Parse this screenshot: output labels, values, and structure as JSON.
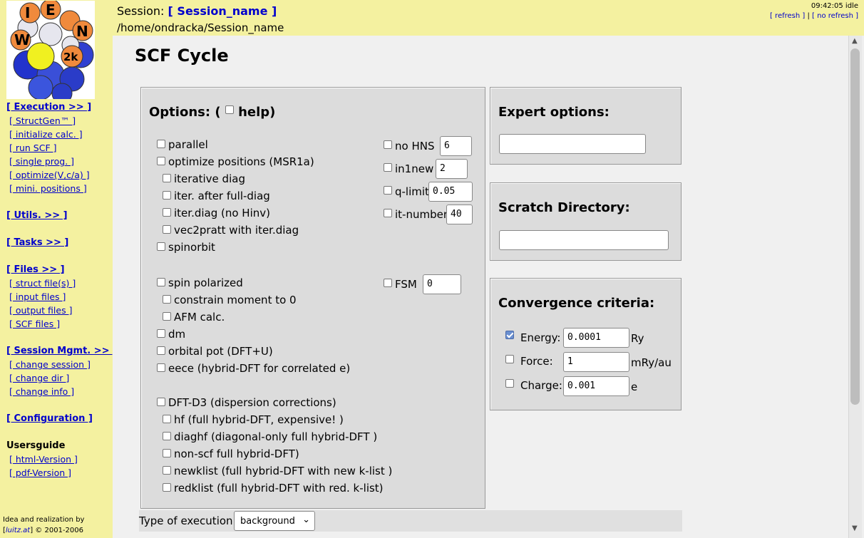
{
  "sidebar": {
    "logo_letters": [
      "W",
      "I",
      "E",
      "N",
      "2k"
    ],
    "nav": [
      {
        "label": "[ Execution >> ]",
        "style": "bold"
      },
      {
        "label": "[ StructGen™ ]",
        "style": "sub"
      },
      {
        "label": "[ initialize calc. ]",
        "style": "sub"
      },
      {
        "label": "[ run SCF ]",
        "style": "sub"
      },
      {
        "label": "[ single prog. ]",
        "style": "sub"
      },
      {
        "label": "[ optimize(V,c/a) ]",
        "style": "sub"
      },
      {
        "label": "[ mini. positions ]",
        "style": "sub"
      },
      {
        "label": "[ Utils. >> ]",
        "style": "bold"
      },
      {
        "label": "[ Tasks >> ]",
        "style": "bold"
      },
      {
        "label": "[ Files >> ]",
        "style": "bold"
      },
      {
        "label": "[ struct file(s) ]",
        "style": "sub"
      },
      {
        "label": "[ input files ]",
        "style": "sub"
      },
      {
        "label": "[ output files ]",
        "style": "sub"
      },
      {
        "label": "[ SCF files ]",
        "style": "sub"
      },
      {
        "label": "[ Session Mgmt. >> ]",
        "style": "bold"
      },
      {
        "label": "[ change session ]",
        "style": "sub"
      },
      {
        "label": "[ change dir ]",
        "style": "sub"
      },
      {
        "label": "[ change info ]",
        "style": "sub"
      },
      {
        "label": "[ Configuration ]",
        "style": "bold"
      },
      {
        "label": "Usersguide",
        "style": "plain"
      },
      {
        "label": "[ html-Version ]",
        "style": "sub"
      },
      {
        "label": "[ pdf-Version ]",
        "style": "sub"
      }
    ],
    "credit_line1": "Idea and realization by",
    "credit_link": "luitz.at",
    "credit_suffix": "© 2001-2006"
  },
  "header": {
    "session_prefix": "Session:",
    "session_name": "[ Session_name ]",
    "path": "/home/ondracka/Session_name",
    "clock": "09:42:05 idle",
    "refresh": "[ refresh ]",
    "separator": "|",
    "no_refresh": "[ no refresh ]"
  },
  "main": {
    "title": "SCF Cycle",
    "options": {
      "title_prefix": "Options: (",
      "help_label": "help)",
      "left": [
        {
          "label": "parallel",
          "checked": false
        },
        {
          "label": "optimize positions (MSR1a)",
          "checked": false
        },
        {
          "label": "iterative diag",
          "checked": false
        },
        {
          "label": "iter. after full-diag",
          "checked": false
        },
        {
          "label": "iter.diag (no Hinv)",
          "checked": false
        },
        {
          "label": "vec2pratt with iter.diag",
          "checked": false
        },
        {
          "label": "spinorbit",
          "checked": false
        },
        {
          "label": "spin polarized",
          "checked": false
        },
        {
          "label": "constrain moment to 0",
          "checked": false
        },
        {
          "label": "AFM calc.",
          "checked": false
        },
        {
          "label": "dm",
          "checked": false
        },
        {
          "label": "orbital pot (DFT+U)",
          "checked": false
        },
        {
          "label": "eece (hybrid-DFT for correlated e)",
          "checked": false
        },
        {
          "label": "DFT-D3 (dispersion corrections)",
          "checked": false
        },
        {
          "label": "hf (full hybrid-DFT, expensive! )",
          "checked": false
        },
        {
          "label": "diaghf (diagonal-only full hybrid-DFT )",
          "checked": false
        },
        {
          "label": "non-scf full hybrid-DFT)",
          "checked": false
        },
        {
          "label": "newklist (full hybrid-DFT with new k-list )",
          "checked": false
        },
        {
          "label": "redklist (full hybrid-DFT with red. k-list)",
          "checked": false
        }
      ],
      "right": [
        {
          "label": "no HNS",
          "value": "6"
        },
        {
          "label": "in1new",
          "value": "2"
        },
        {
          "label": "q-limit",
          "value": "0.05"
        },
        {
          "label": "it-number",
          "value": "40"
        },
        {
          "label": "FSM",
          "value": "0"
        }
      ]
    },
    "expert": {
      "title": "Expert options:",
      "value": ""
    },
    "scratch": {
      "title": "Scratch Directory:",
      "value": ""
    },
    "convergence": {
      "title": "Convergence criteria:",
      "rows": [
        {
          "label": "Energy:",
          "value": "0.0001",
          "unit": "Ry",
          "checked": true
        },
        {
          "label": "Force:",
          "value": "1",
          "unit": "mRy/au",
          "checked": false
        },
        {
          "label": "Charge:",
          "value": "0.001",
          "unit": "e",
          "checked": false
        }
      ]
    },
    "execution": {
      "label": "Type of execution:",
      "selected": "background"
    }
  },
  "colors": {
    "sidebar_bg": "#f4f1a0",
    "link": "#0000cc",
    "panel_bg": "#dcdcdc",
    "checked": "#6a8fd0"
  }
}
